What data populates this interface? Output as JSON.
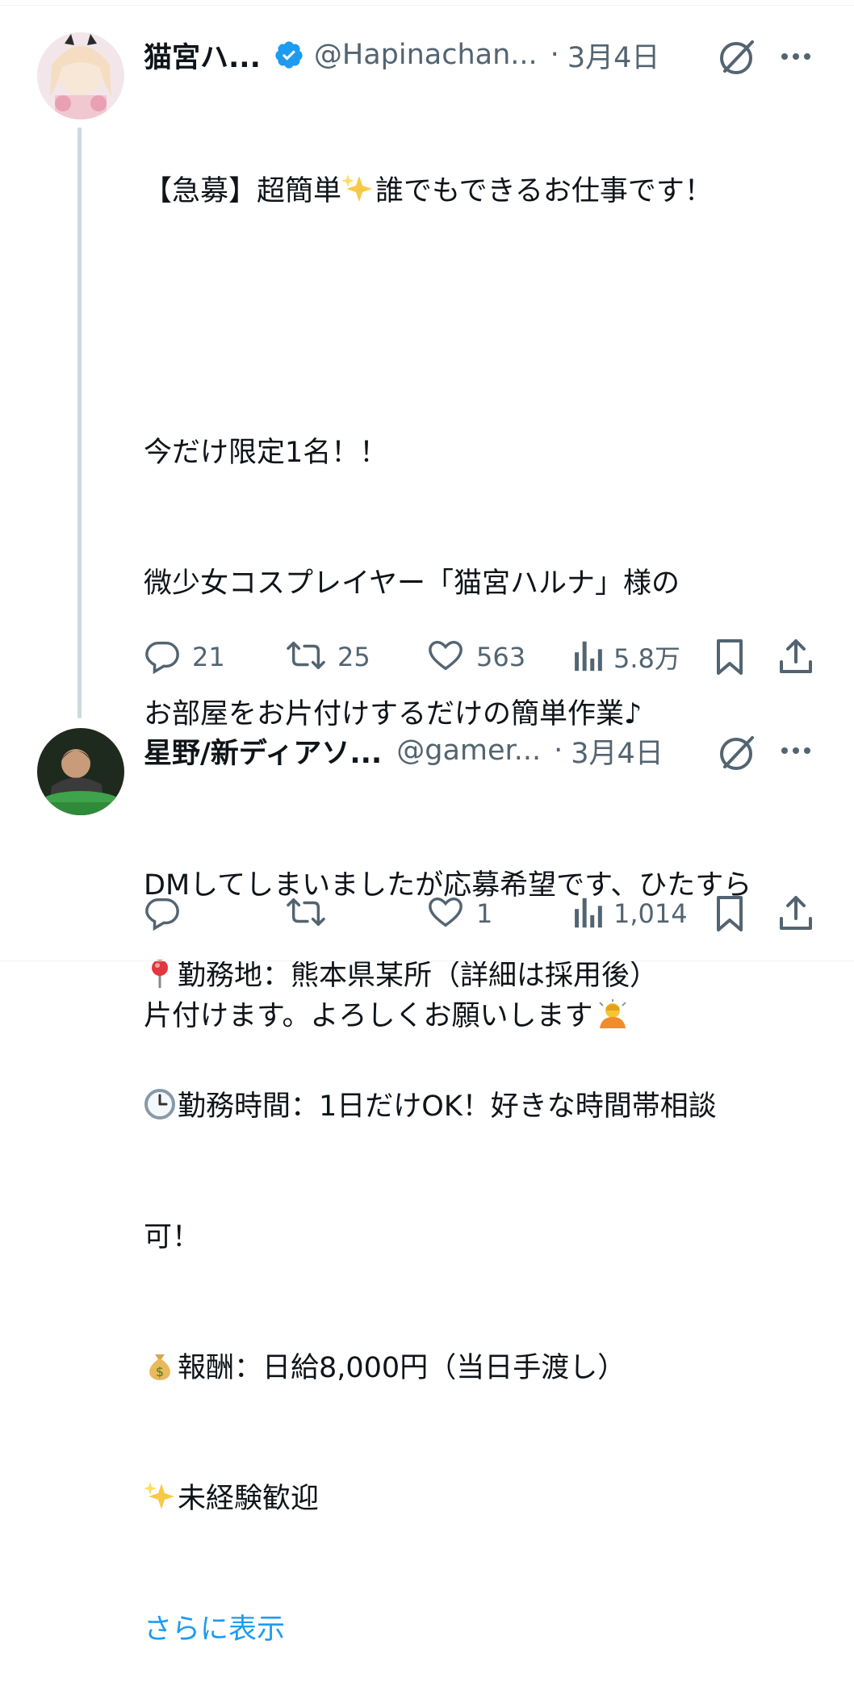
{
  "tweet1": {
    "display_name": "猫宮ハ...",
    "handle": "@Hapinachan...",
    "separator": "·",
    "date": "3月4日",
    "lines": {
      "l1": "【急募】超簡単",
      "l1b": "誰でもできるお仕事です！",
      "l3": "今だけ限定1名！！",
      "l4": "微少女コスプレイヤー「猫宮ハルナ」様の",
      "l5": "お部屋をお片付けするだけの簡単作業♪",
      "l7": "勤務地：熊本県某所（詳細は採用後）",
      "l8": "勤務時間：1日だけOK！好きな時間帯相談",
      "l9": "可！",
      "l10": "報酬：日給8,000円（当日手渡し）",
      "l11": "未経験歓迎"
    },
    "show_more": "さらに表示",
    "stats": {
      "replies": "21",
      "reposts": "25",
      "likes": "563",
      "views": "5.8万"
    }
  },
  "tweet2": {
    "display_name": "星野/新ディアソ...",
    "handle": "@gamer...",
    "separator": "·",
    "date": "3月4日",
    "lines": {
      "l1": "DMしてしまいましたが応募希望です、ひたすら",
      "l2": "片付けます。よろしくお願いします"
    },
    "stats": {
      "replies": "",
      "reposts": "",
      "likes": "1",
      "views": "1,014"
    }
  },
  "icons": [
    "verified-badge-icon",
    "grok-icon",
    "more-icon",
    "reply-icon",
    "repost-icon",
    "like-icon",
    "views-icon",
    "bookmark-icon",
    "share-icon",
    "sparkles-emoji",
    "pin-emoji",
    "clock-emoji",
    "money-bag-emoji",
    "bowing-person-emoji"
  ],
  "colors": {
    "text": "#0f1419",
    "secondary": "#536471",
    "link": "#1d9bf0",
    "thread": "#cfd9de"
  }
}
